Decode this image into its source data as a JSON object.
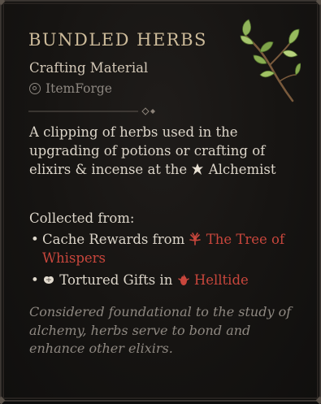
{
  "item": {
    "name": "BUNDLED HERBS",
    "type": "Crafting Material",
    "source_label": "ItemForge",
    "description_before_icon": "A clipping of herbs used in the upgrading of potions or crafting of elixirs & incense at the",
    "vendor": "Alchemist",
    "collected_label": "Collected from:",
    "sources": [
      {
        "bullet": "•",
        "prefix": "Cache Rewards from",
        "place": "The Tree of Whispers",
        "icon": "tree-of-whispers-icon"
      },
      {
        "bullet": "•",
        "prefix": "Tortured Gifts in",
        "place": "Helltide",
        "icon": "helltide-icon",
        "lead_icon": "tortured-gift-icon"
      }
    ],
    "flavor": "Considered foundational to the study of alchemy, herbs serve to bond and enhance other elixirs."
  },
  "icons": {
    "item_art": "herb-sprig-icon",
    "source_icon": "itemforge-icon",
    "vendor_icon": "alchemist-icon"
  },
  "colors": {
    "title": "#cdbb9a",
    "highlight_red": "#c8463c",
    "flavor": "#8e8881",
    "body": "#ddd6ca"
  }
}
